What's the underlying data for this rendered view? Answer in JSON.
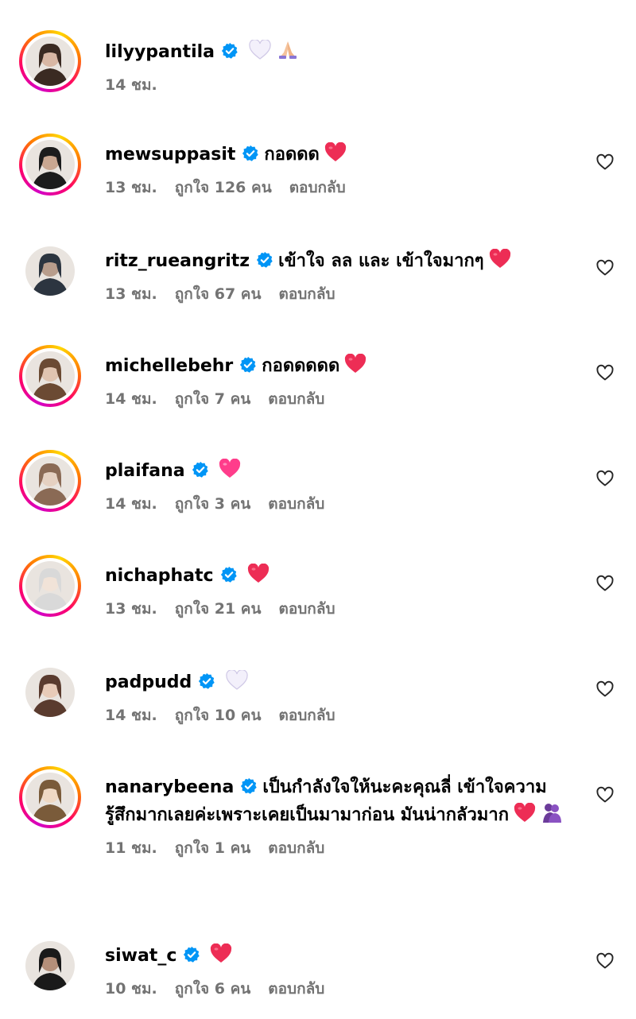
{
  "comments": [
    {
      "username": "lilyypantila",
      "verified": true,
      "text": "",
      "emojis": [
        "white-heart",
        "pray"
      ],
      "time": "14 ชม.",
      "likes": "",
      "reply": "",
      "has_ring": true,
      "show_like": false
    },
    {
      "username": "mewsuppasit",
      "verified": true,
      "text": "กอดดด",
      "emojis": [
        "red-heart"
      ],
      "time": "13 ชม.",
      "likes": "ถูกใจ 126 คน",
      "reply": "ตอบกลับ",
      "has_ring": true,
      "show_like": true
    },
    {
      "username": "ritz_rueangritz",
      "verified": true,
      "text": "เข้าใจ ลล และ เข้าใจมากๆ",
      "emojis": [
        "red-heart"
      ],
      "time": "13 ชม.",
      "likes": "ถูกใจ 67 คน",
      "reply": "ตอบกลับ",
      "has_ring": false,
      "show_like": true
    },
    {
      "username": "michellebehr",
      "verified": true,
      "text": "กอดดดดด",
      "emojis": [
        "red-heart"
      ],
      "time": "14 ชม.",
      "likes": "ถูกใจ 7 คน",
      "reply": "ตอบกลับ",
      "has_ring": true,
      "show_like": true
    },
    {
      "username": "plaifana",
      "verified": true,
      "text": "",
      "emojis": [
        "pink-heart"
      ],
      "time": "14 ชม.",
      "likes": "ถูกใจ 3 คน",
      "reply": "ตอบกลับ",
      "has_ring": true,
      "show_like": true
    },
    {
      "username": "nichaphatc",
      "verified": true,
      "text": "",
      "emojis": [
        "red-heart"
      ],
      "time": "13 ชม.",
      "likes": "ถูกใจ 21 คน",
      "reply": "ตอบกลับ",
      "has_ring": true,
      "show_like": true
    },
    {
      "username": "padpudd",
      "verified": true,
      "text": "",
      "emojis": [
        "white-heart"
      ],
      "time": "14 ชม.",
      "likes": "ถูกใจ 10 คน",
      "reply": "ตอบกลับ",
      "has_ring": false,
      "show_like": true
    },
    {
      "username": "nanarybeena",
      "verified": true,
      "text": "เป็นกำลังใจให้นะคะคุณลี่ เข้าใจความรู้สึกมากเลยค่ะเพราะเคยเป็นมามาก่อน มันน่ากลัวมาก",
      "emojis": [
        "red-heart",
        "hug"
      ],
      "time": "11 ชม.",
      "likes": "ถูกใจ 1 คน",
      "reply": "ตอบกลับ",
      "has_ring": true,
      "show_like": true
    },
    {
      "username": "siwat_c",
      "verified": true,
      "text": "",
      "emojis": [
        "red-heart"
      ],
      "time": "10 ชม.",
      "likes": "ถูกใจ 6 คน",
      "reply": "ตอบกลับ",
      "has_ring": false,
      "show_like": true
    }
  ],
  "colors": {
    "verified": "#0095f6",
    "meta": "#737373",
    "heart_red": "#ed2d55",
    "heart_pink": "#ff3d8b"
  }
}
